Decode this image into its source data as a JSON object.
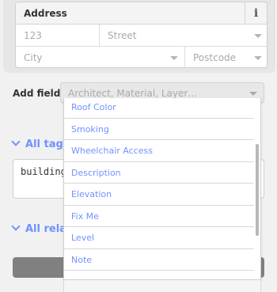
{
  "address": {
    "title": "Address",
    "info_glyph": "i",
    "housenumber_placeholder": "123",
    "street_placeholder": "Street",
    "city_placeholder": "City",
    "postcode_placeholder": "Postcode"
  },
  "add_field": {
    "label": "Add field:",
    "placeholder": "Architect, Material, Layer…"
  },
  "sections": {
    "all_tags": "All tags",
    "all_relations": "All relat",
    "tags_text": "buildings"
  },
  "dropdown": {
    "items": [
      "Roof Color",
      "Smoking",
      "Wheelchair Access",
      "Description",
      "Elevation",
      "Fix Me",
      "Level",
      "Note"
    ]
  },
  "colors": {
    "link": "#7092ff",
    "panel": "#e6e6e6",
    "button": "#808080"
  }
}
